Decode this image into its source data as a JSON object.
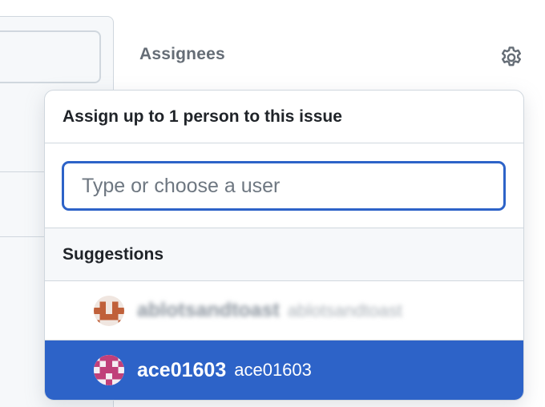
{
  "sidebar": {
    "heading": "Assignees",
    "settings_icon": "gear-icon"
  },
  "popover": {
    "title": "Assign up to 1 person to this issue",
    "filter": {
      "placeholder": "Type or choose a user",
      "value": ""
    },
    "section_label": "Suggestions",
    "users": [
      {
        "login": "ablotsandtoast",
        "name": "ablotsandtoast",
        "avatar_color": "#c0603a",
        "selected": false,
        "blurred": true
      },
      {
        "login": "ace01603",
        "name": "ace01603",
        "avatar_color": "#c0407a",
        "selected": true,
        "blurred": false
      }
    ]
  },
  "colors": {
    "accent": "#2d63c8",
    "border": "#d0d7de",
    "muted_text": "#656d76",
    "canvas_subtle": "#f6f8fa"
  }
}
